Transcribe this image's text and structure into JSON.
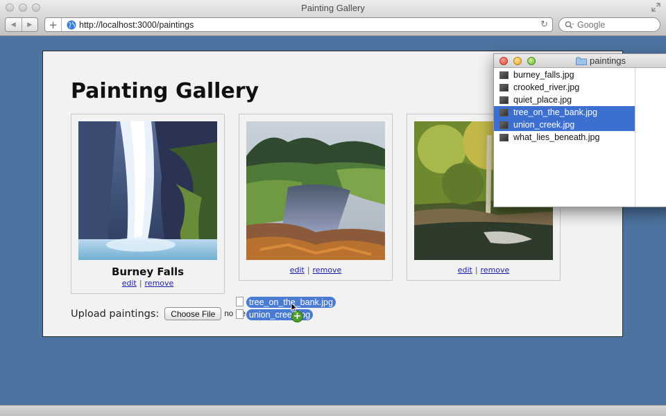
{
  "browser": {
    "title": "Painting Gallery",
    "url": "http://localhost:3000/paintings",
    "search_placeholder": "Google",
    "new_tab_symbol": "+",
    "back_symbol": "◀",
    "forward_symbol": "▶",
    "reload_symbol": "↻"
  },
  "page": {
    "heading": "Painting Gallery",
    "cards": [
      {
        "title": "Burney Falls",
        "edit": "edit",
        "remove": "remove"
      },
      {
        "title": "",
        "edit": "edit",
        "remove": "remove"
      },
      {
        "title": "",
        "edit": "edit",
        "remove": "remove"
      }
    ],
    "separator": "|",
    "upload_label": "Upload paintings:",
    "choose_file": "Choose File",
    "no_file": "no file s"
  },
  "drag": {
    "files": [
      "tree_on_the_bank.jpg",
      "union_creek.jpg"
    ],
    "badge": "+"
  },
  "finder": {
    "title": "paintings",
    "files": [
      {
        "name": "burney_falls.jpg",
        "selected": false
      },
      {
        "name": "crooked_river.jpg",
        "selected": false
      },
      {
        "name": "quiet_place.jpg",
        "selected": false
      },
      {
        "name": "tree_on_the_bank.jpg",
        "selected": true
      },
      {
        "name": "union_creek.jpg",
        "selected": true
      },
      {
        "name": "what_lies_beneath.jpg",
        "selected": false
      }
    ]
  },
  "colors": {
    "desktop": "#4d74a0",
    "selection": "#3d6fd1",
    "drag_pill": "#4a7bd3",
    "link": "#1a1aa6"
  },
  "icons": [
    "globe-icon",
    "search-icon",
    "reload-icon",
    "folder-icon",
    "cursor-icon",
    "plus-badge-icon"
  ]
}
